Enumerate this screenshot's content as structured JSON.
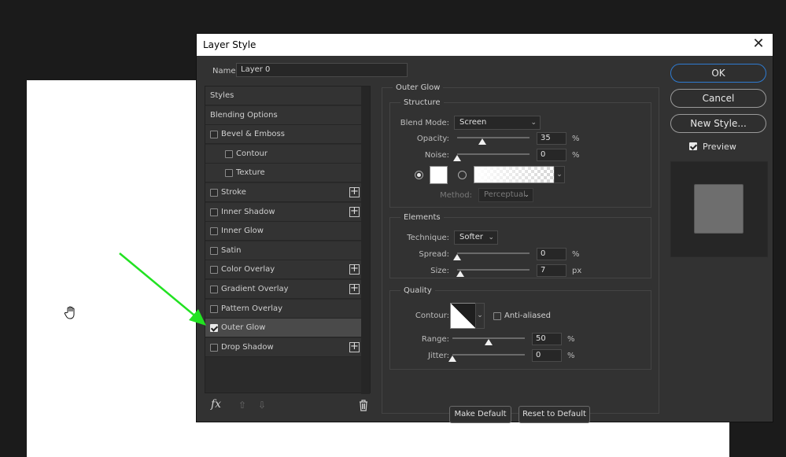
{
  "dialog": {
    "title": "Layer Style",
    "close": "✕"
  },
  "name": {
    "label": "Name:",
    "value": "Layer 0"
  },
  "styles_list": [
    {
      "label": "Styles"
    },
    {
      "label": "Blending Options"
    },
    {
      "label": "Bevel & Emboss",
      "checked": false
    },
    {
      "label": "Contour",
      "checked": false
    },
    {
      "label": "Texture",
      "checked": false
    },
    {
      "label": "Stroke",
      "checked": false,
      "plus": "+"
    },
    {
      "label": "Inner Shadow",
      "checked": false,
      "plus": "+"
    },
    {
      "label": "Inner Glow",
      "checked": false
    },
    {
      "label": "Satin",
      "checked": false
    },
    {
      "label": "Color Overlay",
      "checked": false,
      "plus": "+"
    },
    {
      "label": "Gradient Overlay",
      "checked": false,
      "plus": "+"
    },
    {
      "label": "Pattern Overlay",
      "checked": false
    },
    {
      "label": "Outer Glow",
      "checked": true,
      "selected": true
    },
    {
      "label": "Drop Shadow",
      "checked": false,
      "plus": "+"
    }
  ],
  "list_footer": {
    "fx": "fx",
    "up": "⇧",
    "down": "⇩",
    "icons": [
      "move-up-icon",
      "move-down-icon",
      "trash-icon"
    ]
  },
  "outer_glow": {
    "title": "Outer Glow",
    "structure": {
      "title": "Structure",
      "blend_mode_label": "Blend Mode:",
      "blend_mode_value": "Screen",
      "opacity_label": "Opacity:",
      "opacity_value": "35",
      "opacity_unit": "%",
      "opacity_pct": 35,
      "noise_label": "Noise:",
      "noise_value": "0",
      "noise_unit": "%",
      "noise_pct": 0,
      "color_swatch": "#ffffff",
      "method_label": "Method:",
      "method_value": "Perceptual"
    },
    "elements": {
      "title": "Elements",
      "technique_label": "Technique:",
      "technique_value": "Softer",
      "spread_label": "Spread:",
      "spread_value": "0",
      "spread_unit": "%",
      "spread_pct": 0,
      "size_label": "Size:",
      "size_value": "7",
      "size_unit": "px",
      "size_pct": 4
    },
    "quality": {
      "title": "Quality",
      "contour_label": "Contour:",
      "anti_aliased_label": "Anti-aliased",
      "anti_aliased": false,
      "range_label": "Range:",
      "range_value": "50",
      "range_unit": "%",
      "range_pct": 50,
      "jitter_label": "Jitter:",
      "jitter_value": "0",
      "jitter_unit": "%",
      "jitter_pct": 0
    },
    "make_default": "Make Default",
    "reset_default": "Reset to Default"
  },
  "buttons": {
    "ok": "OK",
    "cancel": "Cancel",
    "new_style": "New Style...",
    "preview_label": "Preview",
    "preview_checked": true
  },
  "colors": {
    "accent": "#2f7bd1",
    "arrow": "#22e222"
  }
}
